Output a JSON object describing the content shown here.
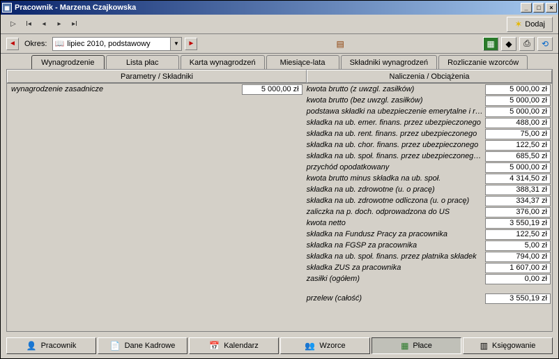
{
  "titlebar": {
    "title": "Pracownik - Marzena Czajkowska"
  },
  "toolbar1": {
    "add_label": "Dodaj"
  },
  "toolbar2": {
    "okres_label": "Okres:",
    "period_value": "lipiec 2010, podstawowy"
  },
  "top_tabs": {
    "t0": "Wynagrodzenie",
    "t1": "Lista płac",
    "t2": "Karta wynagrodzeń",
    "t3": "Miesiące-lata",
    "t4": "Składniki wynagrodzeń",
    "t5": "Rozliczanie wzorców"
  },
  "col_headers": {
    "left": "Parametry / Składniki",
    "right": "Naliczenia / Obciążenia"
  },
  "left_items": [
    {
      "label": "wynagrodzenie zasadnicze",
      "value": "5 000,00 zł"
    }
  ],
  "right_items": [
    {
      "label": "kwota brutto (z uwzgl. zasiłków)",
      "value": "5 000,00 zł"
    },
    {
      "label": "kwota brutto (bez uwzgl. zasiłków)",
      "value": "5 000,00 zł"
    },
    {
      "label": "podstawa składki na ubezpieczenie emerytalne i re...",
      "value": "5 000,00 zł"
    },
    {
      "label": "składka na ub. emer. finans. przez ubezpieczonego",
      "value": "488,00 zł"
    },
    {
      "label": "składka na ub. rent. finans. przez ubezpieczonego",
      "value": "75,00 zł"
    },
    {
      "label": "składka na ub. chor. finans. przez ubezpieczonego",
      "value": "122,50 zł"
    },
    {
      "label": "składka na ub. społ. finans. przez ubezpieczonego ...",
      "value": "685,50 zł"
    },
    {
      "label": "przychód opodatkowany",
      "value": "5 000,00 zł"
    },
    {
      "label": "kwota brutto minus składka na ub. społ.",
      "value": "4 314,50 zł"
    },
    {
      "label": "składka na ub. zdrowotne (u. o pracę)",
      "value": "388,31 zł"
    },
    {
      "label": "składka na ub. zdrowotne odliczona (u. o pracę)",
      "value": "334,37 zł"
    },
    {
      "label": "zaliczka na p. doch. odprowadzona do US",
      "value": "376,00 zł"
    },
    {
      "label": "kwota netto",
      "value": "3 550,19 zł"
    },
    {
      "label": "składka na Fundusz Pracy za pracownika",
      "value": "122,50 zł"
    },
    {
      "label": "składka na FGŚP za pracownika",
      "value": "5,00 zł"
    },
    {
      "label": "składka na ub. społ. finans. przez płatnika składek",
      "value": "794,00 zł"
    },
    {
      "label": "składka ZUS za pracownika",
      "value": "1 607,00 zł"
    },
    {
      "label": "zasiłki (ogółem)",
      "value": "0,00 zł"
    }
  ],
  "right_footer": {
    "label": "przelew (całość)",
    "value": "3 550,19 zł"
  },
  "bottom_tabs": {
    "b0": "Pracownik",
    "b1": "Dane Kadrowe",
    "b2": "Kalendarz",
    "b3": "Wzorce",
    "b4": "Płace",
    "b5": "Księgowanie"
  }
}
